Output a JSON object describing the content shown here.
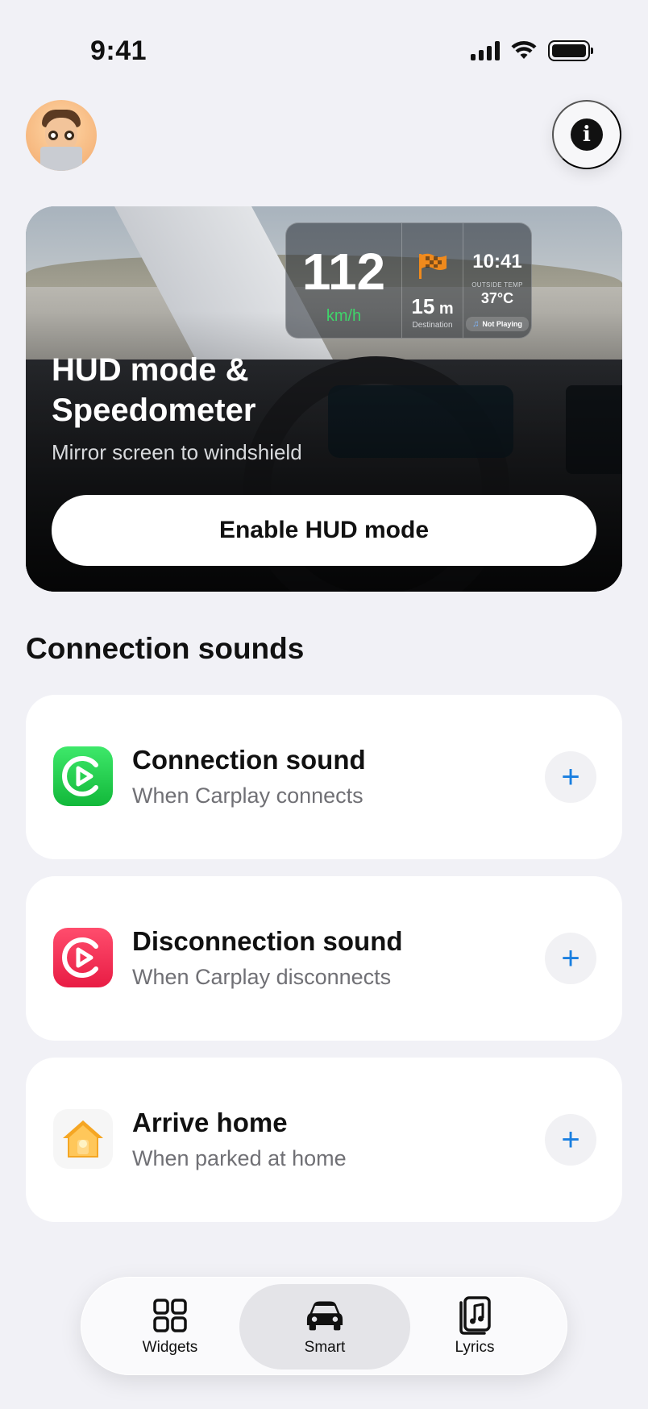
{
  "status_bar": {
    "time": "9:41",
    "icons": [
      "cellular-signal-icon",
      "wifi-icon",
      "battery-icon"
    ]
  },
  "header": {
    "avatar": "memoji-avatar",
    "info_icon": "info-icon"
  },
  "hud_card": {
    "title": "HUD mode & Speedometer",
    "subtitle": "Mirror screen to windshield",
    "button_label": "Enable HUD mode",
    "preview": {
      "speed": "112",
      "speed_unit": "km/h",
      "distance_value": "15",
      "distance_unit": "m",
      "distance_label": "Destination",
      "clock": "10:41",
      "temp_label": "OUTSIDE TEMP",
      "temp": "37°C",
      "now_playing": "Not Playing"
    }
  },
  "section": {
    "title": "Connection sounds"
  },
  "sounds": [
    {
      "title": "Connection sound",
      "subtitle": "When Carplay connects",
      "icon": "carplay-connect-icon",
      "action": "+"
    },
    {
      "title": "Disconnection sound",
      "subtitle": "When Carplay disconnects",
      "icon": "carplay-disconnect-icon",
      "action": "+"
    },
    {
      "title": "Arrive home",
      "subtitle": "When parked at home",
      "icon": "home-icon",
      "action": "+"
    }
  ],
  "tab_bar": {
    "tabs": [
      {
        "label": "Widgets",
        "icon": "grid-icon",
        "selected": false
      },
      {
        "label": "Smart",
        "icon": "car-icon",
        "selected": true
      },
      {
        "label": "Lyrics",
        "icon": "music-note-icon",
        "selected": false
      }
    ]
  },
  "colors": {
    "background": "#f1f1f6",
    "accent": "#1a7fe0",
    "speed_unit": "#3fd56a",
    "flag": "#f08a1c"
  }
}
